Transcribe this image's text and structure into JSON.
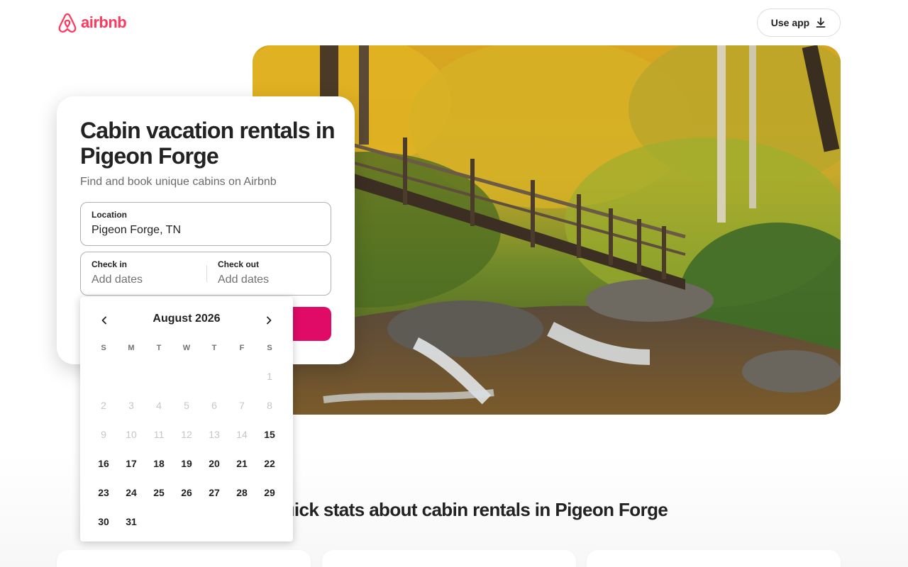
{
  "header": {
    "brand": "airbnb",
    "use_app_label": "Use app"
  },
  "hero": {
    "image_subject": "wooden footbridge over a cascading creek in an autumn forest"
  },
  "search_card": {
    "title": "Cabin vacation rentals in Pigeon Forge",
    "subtitle": "Find and book unique cabins on Airbnb",
    "location": {
      "label": "Location",
      "value": "Pigeon Forge, TN"
    },
    "check_in": {
      "label": "Check in",
      "placeholder": "Add dates"
    },
    "check_out": {
      "label": "Check out",
      "placeholder": "Add dates"
    }
  },
  "calendar": {
    "month": "August 2026",
    "weekdays": [
      "S",
      "M",
      "T",
      "W",
      "T",
      "F",
      "S"
    ],
    "first_weekday_index": 6,
    "days_in_month": 31,
    "first_available_day": 15
  },
  "stats": {
    "heading": "Quick stats about cabin rentals in Pigeon Forge",
    "visible_heading": "k stats about cabin rentals in Pigeon Forge"
  },
  "colors": {
    "brand": "#FF385C",
    "search_button": "#E00B66",
    "text_primary": "#222222",
    "text_secondary": "#6a6a6a",
    "disabled_day": "#c6c6c6"
  },
  "icons": {
    "logo": "airbnb-belo-icon",
    "use_app": "download-icon",
    "prev": "chevron-left-icon",
    "next": "chevron-right-icon"
  }
}
